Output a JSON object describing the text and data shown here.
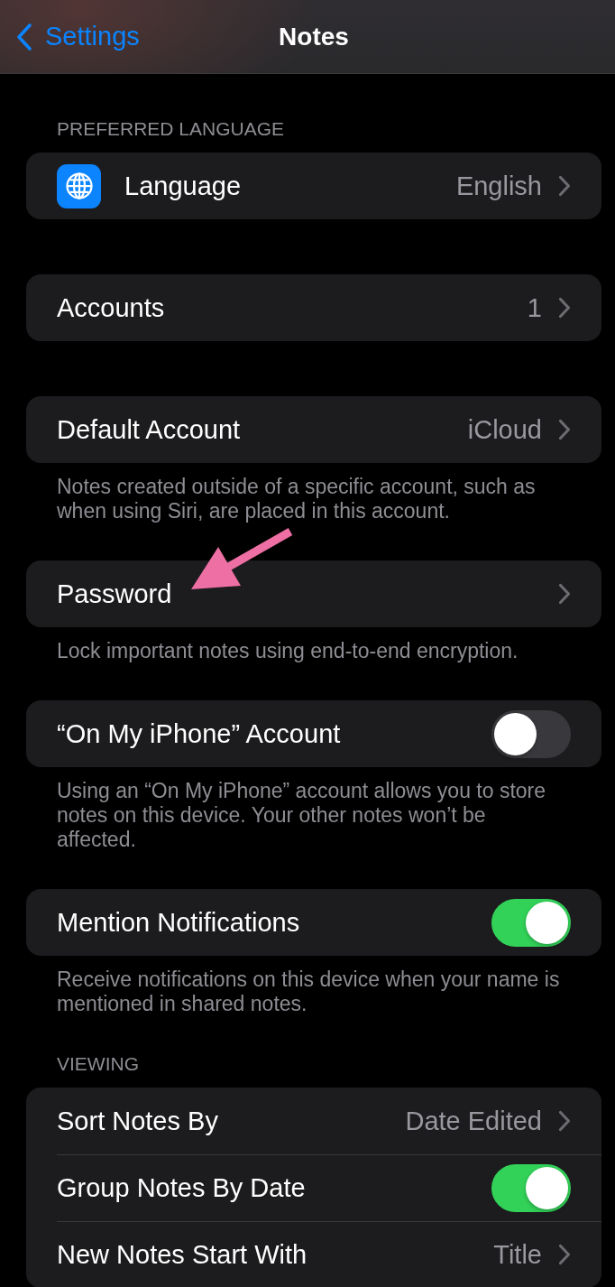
{
  "nav_bar": {
    "back_label": "Settings",
    "title": "Notes"
  },
  "groups": [
    {
      "header": "PREFERRED LANGUAGE",
      "rows": [
        {
          "kind": "icon_link",
          "label": "Language",
          "value": "English"
        }
      ]
    },
    {
      "rows": [
        {
          "kind": "link",
          "label": "Accounts",
          "value": "1"
        }
      ]
    },
    {
      "rows": [
        {
          "kind": "link",
          "label": "Default Account",
          "value": "iCloud"
        }
      ],
      "footer": "Notes created outside of a specific account, such as when using Siri, are placed in this account."
    },
    {
      "rows": [
        {
          "kind": "link",
          "label": "Password"
        }
      ],
      "footer": "Lock important notes using end-to-end encryption."
    },
    {
      "rows": [
        {
          "kind": "toggle",
          "label": "“On My iPhone” Account",
          "on": false
        }
      ],
      "footer": "Using an “On My iPhone” account allows you to store notes on this device. Your other notes won’t be affected."
    },
    {
      "rows": [
        {
          "kind": "toggle",
          "label": "Mention Notifications",
          "on": true
        }
      ],
      "footer": "Receive notifications on this device when your name is mentioned in shared notes."
    },
    {
      "header": "VIEWING",
      "rows": [
        {
          "kind": "link",
          "label": "Sort Notes By",
          "value": "Date Edited"
        },
        {
          "kind": "toggle",
          "label": "Group Notes By Date",
          "on": true
        },
        {
          "kind": "link",
          "label": "New Notes Start With",
          "value": "Title"
        }
      ]
    }
  ],
  "annotation": {
    "kind": "arrow"
  }
}
